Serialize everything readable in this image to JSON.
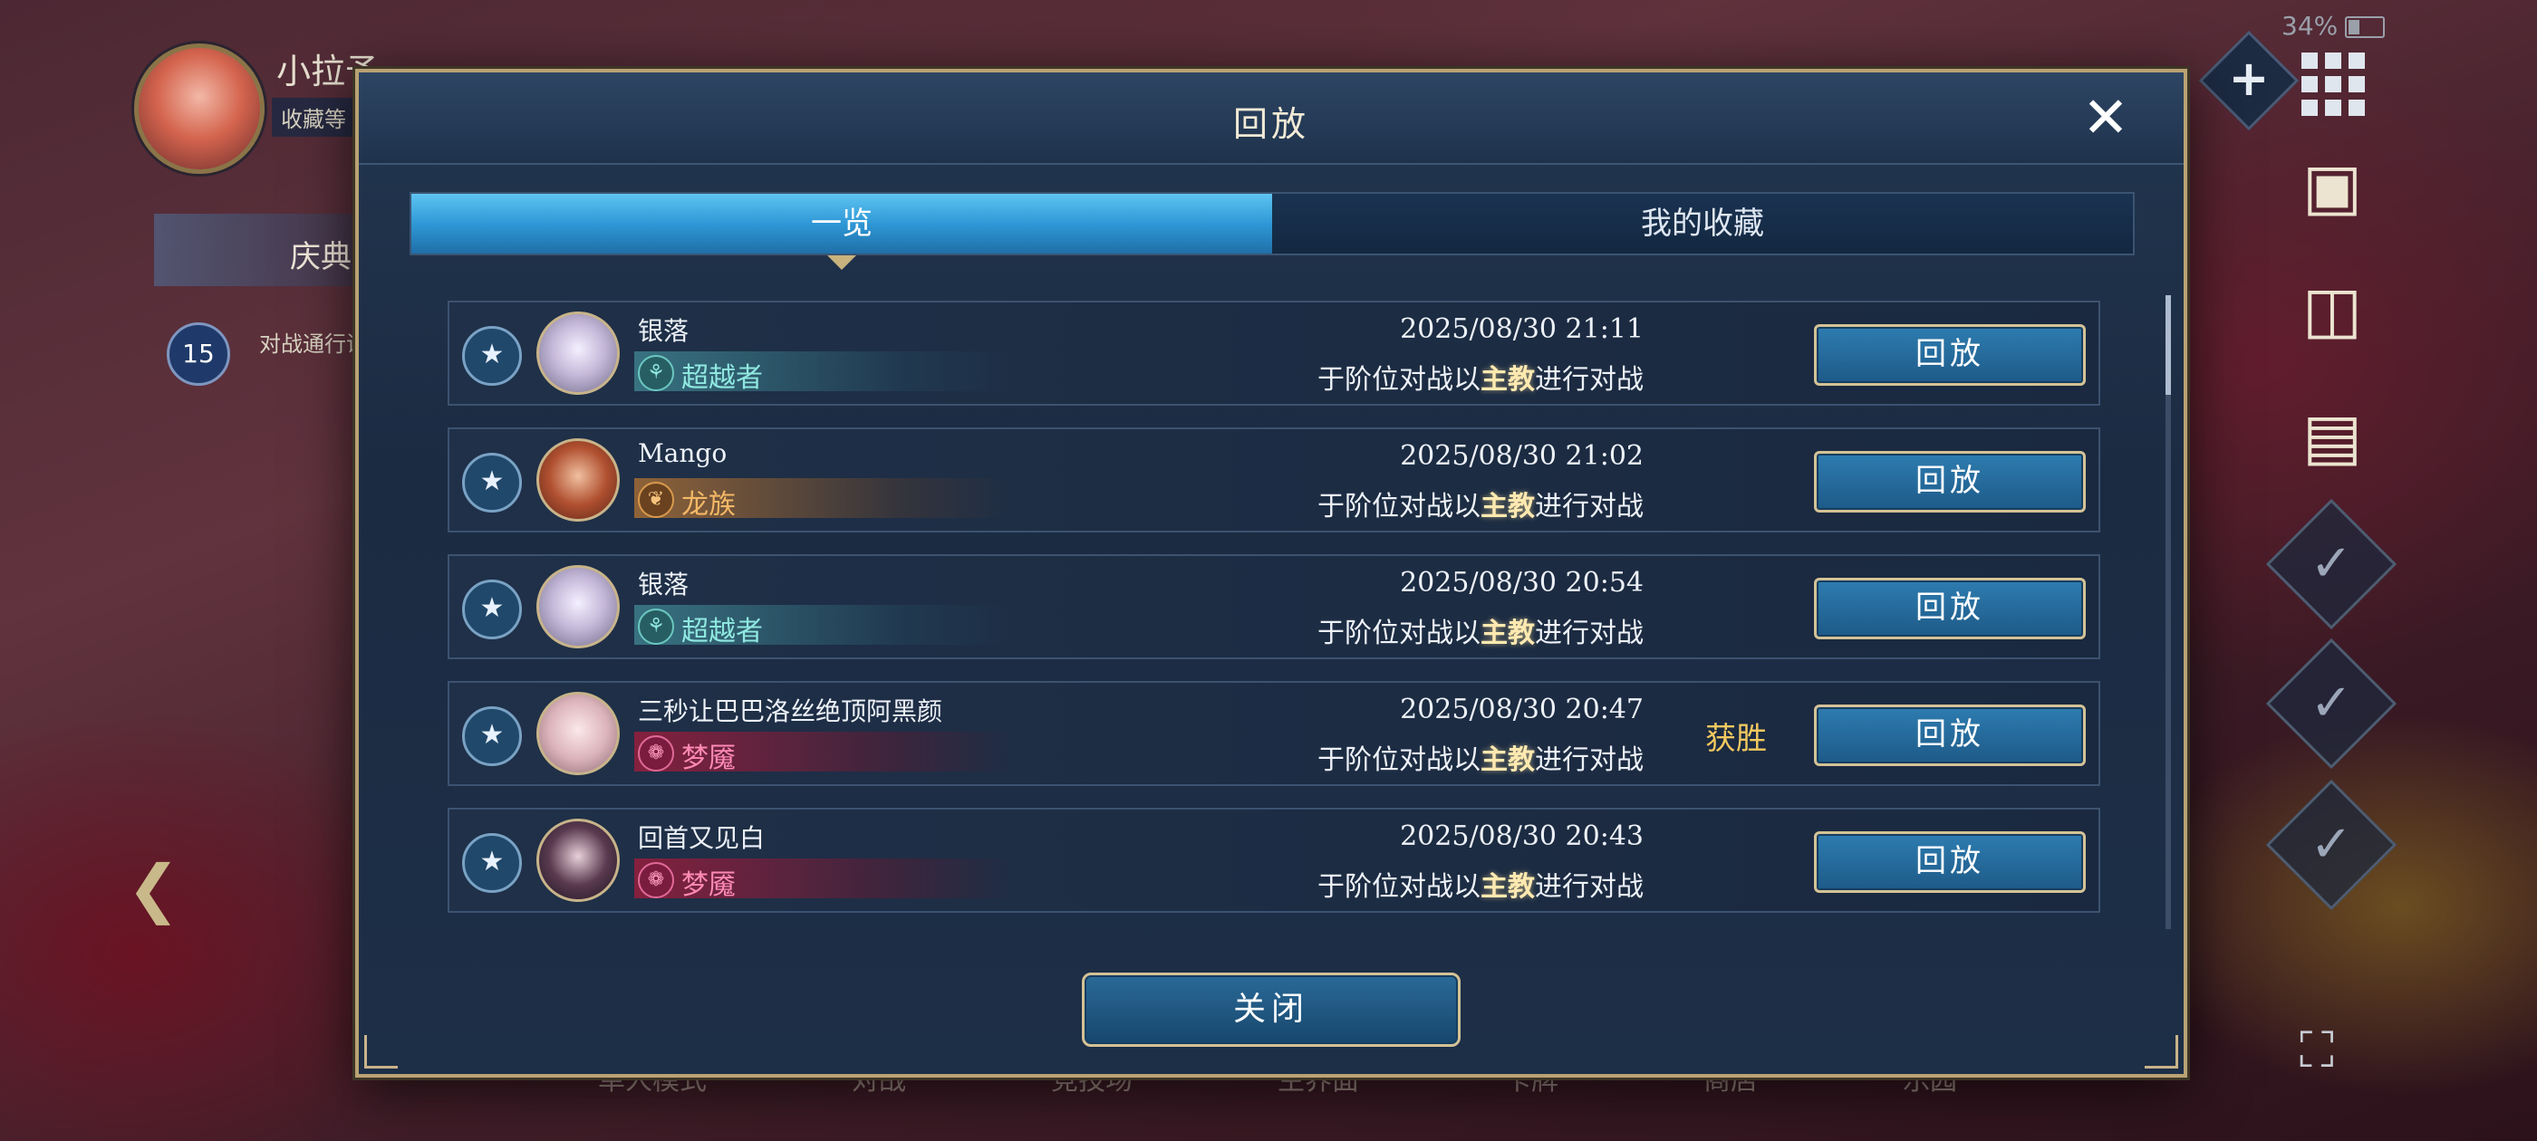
{
  "background": {
    "player_name": "小拉予",
    "collection_label": "收藏等",
    "side_banner_label": "庆典",
    "level": "15",
    "pass_label": "对战通行证 黑",
    "bottom_nav": [
      "单人模式",
      "对战",
      "竞技场",
      "主界面",
      "卡牌",
      "商店",
      "乐园"
    ]
  },
  "status_bar": {
    "battery": "34%"
  },
  "dialog": {
    "title": "回放",
    "tabs": [
      {
        "label": "一览",
        "active": true
      },
      {
        "label": "我的收藏",
        "active": false
      }
    ],
    "replays": [
      {
        "opponent": "银落",
        "class_name": "超越者",
        "class_theme": "teal",
        "class_icon": "leaf-swirl",
        "portrait": "silver",
        "datetime": "2025/08/30  21:11",
        "desc_pre": "于阶位对战以",
        "desc_hl": "主教",
        "desc_post": "进行对战",
        "result": "",
        "button": "回放"
      },
      {
        "opponent": "Mango",
        "class_name": "龙族",
        "class_theme": "orange",
        "class_icon": "dragon",
        "portrait": "dragon",
        "datetime": "2025/08/30  21:02",
        "desc_pre": "于阶位对战以",
        "desc_hl": "主教",
        "desc_post": "进行对战",
        "result": "",
        "button": "回放"
      },
      {
        "opponent": "银落",
        "class_name": "超越者",
        "class_theme": "teal",
        "class_icon": "leaf-swirl",
        "portrait": "silver",
        "datetime": "2025/08/30  20:54",
        "desc_pre": "于阶位对战以",
        "desc_hl": "主教",
        "desc_post": "进行对战",
        "result": "",
        "button": "回放"
      },
      {
        "opponent": "三秒让巴巴洛丝绝顶阿黑颜",
        "class_name": "梦魇",
        "class_theme": "red",
        "class_icon": "nightmare",
        "portrait": "pale",
        "datetime": "2025/08/30  20:47",
        "desc_pre": "于阶位对战以",
        "desc_hl": "主教",
        "desc_post": "进行对战",
        "result": "获胜",
        "button": "回放"
      },
      {
        "opponent": "回首又见白",
        "class_name": "梦魇",
        "class_theme": "red",
        "class_icon": "nightmare",
        "portrait": "dark",
        "datetime": "2025/08/30  20:43",
        "desc_pre": "于阶位对战以",
        "desc_hl": "主教",
        "desc_post": "进行对战",
        "result": "",
        "button": "回放"
      }
    ],
    "close_button": "关闭"
  },
  "colors": {
    "accent_gold": "#b9a274",
    "tab_active": "#2f98d6",
    "win": "#f2c860"
  }
}
